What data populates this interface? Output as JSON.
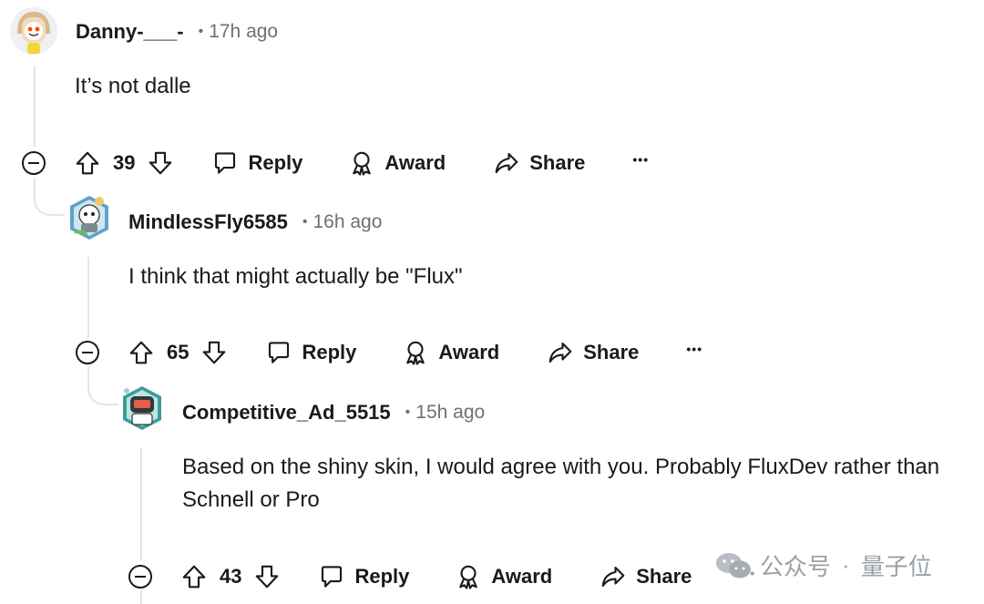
{
  "comments": [
    {
      "username": "Danny-___-",
      "bullet": "•",
      "time": "17h ago",
      "body": "It’s not dalle",
      "votes": "39",
      "reply_label": "Reply",
      "award_label": "Award",
      "share_label": "Share",
      "more_label": "•••"
    },
    {
      "username": "MindlessFly6585",
      "bullet": "•",
      "time": "16h ago",
      "body": "I think that might actually be \"Flux\"",
      "votes": "65",
      "reply_label": "Reply",
      "award_label": "Award",
      "share_label": "Share",
      "more_label": "•••"
    },
    {
      "username": "Competitive_Ad_5515",
      "bullet": "•",
      "time": "15h ago",
      "body": "Based on the shiny skin, I would agree with you. Probably FluxDev rather than Schnell or Pro",
      "votes": "43",
      "reply_label": "Reply",
      "award_label": "Award",
      "share_label": "Share",
      "more_label": "•••"
    }
  ],
  "watermark": {
    "account": "公众号",
    "separator": "·",
    "name": "量子位"
  },
  "colors": {
    "text": "#1a1a1b",
    "meta": "#6b7176",
    "thread": "#e5e5e5"
  }
}
